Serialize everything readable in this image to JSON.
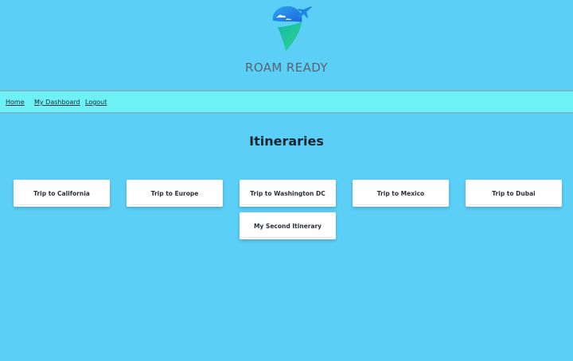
{
  "brand": {
    "name": "ROAM READY",
    "colors": {
      "pin_top": "#3b8fe8",
      "pin_bottom": "#23c9a0",
      "plane": "#1f86e0"
    }
  },
  "nav": {
    "home": "Home",
    "dashboard": "My Dashboard",
    "logout": "Logout"
  },
  "main": {
    "title": "Itineraries",
    "itineraries": [
      "Trip to California",
      "Trip to Europe",
      "Trip to Washington DC",
      "Trip to Mexico",
      "Trip to Dubai",
      "My Second Itinerary"
    ]
  }
}
